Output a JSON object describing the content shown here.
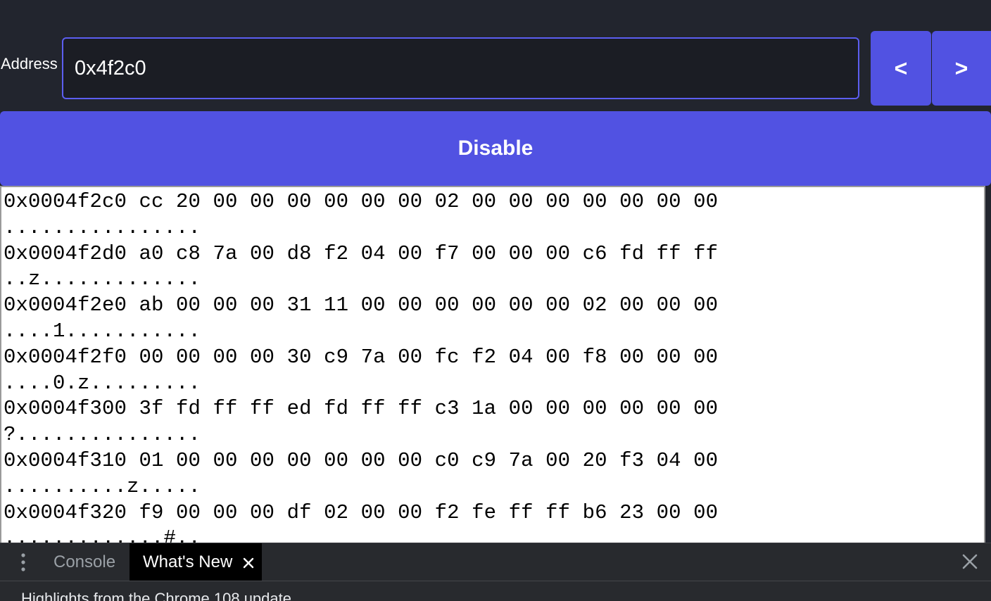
{
  "address": {
    "label": "Address",
    "value": "0x4f2c0"
  },
  "nav": {
    "prev_label": "<",
    "next_label": ">"
  },
  "toggle": {
    "label": "Disable"
  },
  "hex_dump": {
    "lines": [
      "0x0004f2c0 cc 20 00 00 00 00 00 00 02 00 00 00 00 00 00 00",
      "................",
      "0x0004f2d0 a0 c8 7a 00 d8 f2 04 00 f7 00 00 00 c6 fd ff ff",
      "..z.............",
      "0x0004f2e0 ab 00 00 00 31 11 00 00 00 00 00 00 02 00 00 00",
      "....1...........",
      "0x0004f2f0 00 00 00 00 30 c9 7a 00 fc f2 04 00 f8 00 00 00",
      "....0.z.........",
      "0x0004f300 3f fd ff ff ed fd ff ff c3 1a 00 00 00 00 00 00",
      "?...............",
      "0x0004f310 01 00 00 00 00 00 00 00 c0 c9 7a 00 20 f3 04 00",
      "..........z.....",
      "0x0004f320 f9 00 00 00 df 02 00 00 f2 fe ff ff b6 23 00 00",
      ".............#.."
    ]
  },
  "devtools": {
    "tabs": [
      {
        "label": "Console",
        "active": false
      },
      {
        "label": "What's New",
        "active": true,
        "closable": true
      }
    ],
    "content_text": "Highlights from the Chrome 108 update",
    "icons": {
      "menu": "more-vertical-icon",
      "tab_close": "close-icon",
      "drawer_close": "close-icon"
    }
  },
  "colors": {
    "background": "#22252e",
    "accent": "#5152e2",
    "input_border": "#5c5ef0",
    "hex_background": "#ffffff"
  }
}
